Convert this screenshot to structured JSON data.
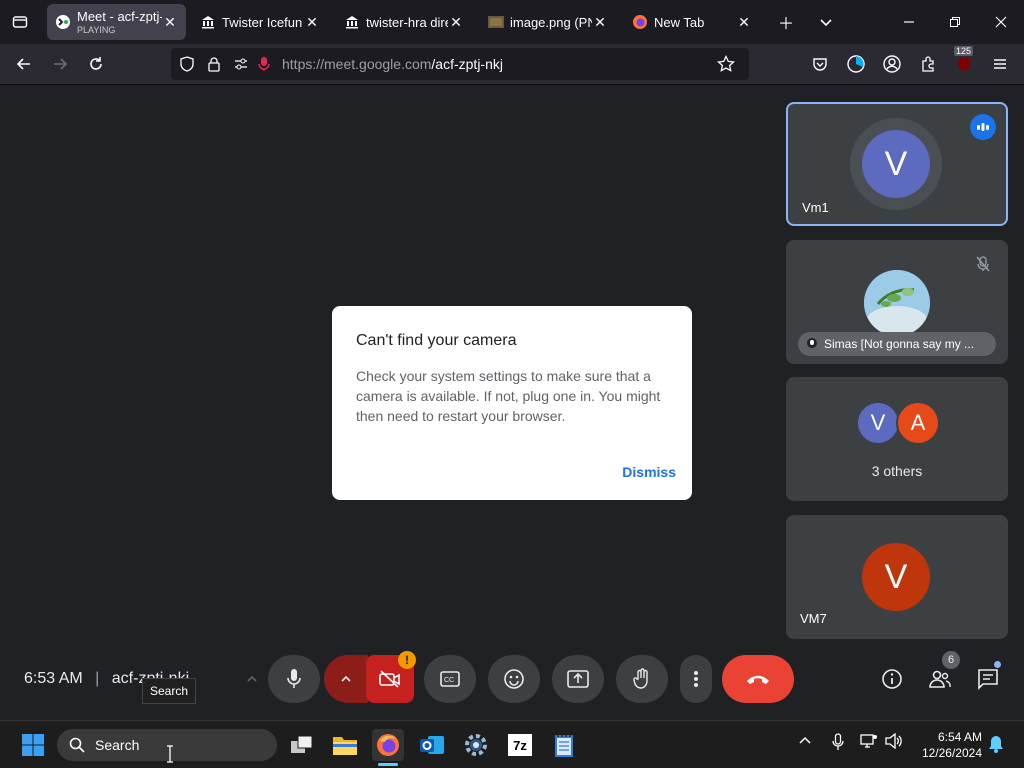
{
  "browser": {
    "tabs": [
      {
        "title": "Meet - acf-zptj-",
        "sub": "PLAYING",
        "active": true
      },
      {
        "title": "Twister Icefun : A"
      },
      {
        "title": "twister-hra direc"
      },
      {
        "title": "image.png (PNG"
      },
      {
        "title": "New Tab"
      }
    ],
    "url_host": "https://meet.google.com",
    "url_path": "/acf-zptj-nkj",
    "ext_badge": "125"
  },
  "meet": {
    "tiles": [
      {
        "initial": "V",
        "name": "Vm1",
        "color": "#5c6bc0"
      },
      {
        "name": "Simas [Not gonna say my ..."
      },
      {
        "initials": [
          "V",
          "A"
        ],
        "label": "3 others",
        "colors": [
          "#5c6bc0",
          "#e64a19"
        ]
      },
      {
        "initial": "V",
        "name": "VM7",
        "color": "#bf360c"
      }
    ],
    "dialog": {
      "title": "Can't find your camera",
      "body": "Check your system settings to make sure that a camera is available. If not, plug one in. You might then need to restart your browser.",
      "dismiss": "Dismiss"
    },
    "time": "6:53 AM",
    "separator": "|",
    "meeting_code": "acf-zptj-nkj",
    "participants_badge": "6",
    "alert_badge": "!",
    "end_call_color": "#ea4335"
  },
  "taskbar": {
    "search_placeholder": "Search",
    "tooltip": "Search",
    "time": "6:54 AM",
    "date": "12/26/2024",
    "app_7z": "7z"
  }
}
